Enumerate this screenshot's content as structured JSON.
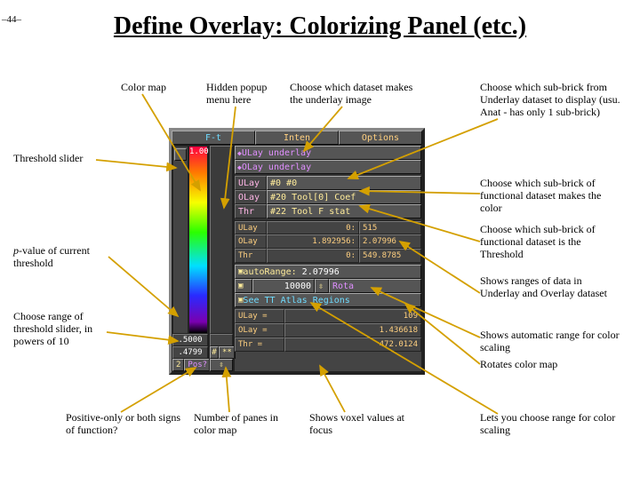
{
  "page_number": "–44–",
  "title": "Define Overlay: Colorizing Panel (etc.)",
  "notes": {
    "colormap": "Color map",
    "hidden_popup": "Hidden popup menu here",
    "choose_underlay_ds": "Choose which dataset makes the underlay image",
    "choose_subbrick_ul": "Choose which sub-brick from Underlay dataset to display (usu. Anat - has only 1 sub-brick)",
    "thresh_slider": "Threshold slider",
    "choose_subbrick_color": "Choose which sub-brick of functional dataset makes the color",
    "pval": "p-value of current threshold",
    "pval_em": "p",
    "pval_rest": "-value of current threshold",
    "choose_subbrick_thr": "Choose which sub-brick of functional dataset is the Threshold",
    "ranges_note": "Shows ranges of data in Underlay and Overlay dataset",
    "range_slider": "Choose range of threshold slider, in powers of 10",
    "auto_range": "Shows automatic range for color scaling",
    "rota": "Rotates color map",
    "posneg": "Positive-only or both signs of function?",
    "panes": "Number of panes in color map",
    "voxel_focus": "Shows voxel values at focus",
    "user_range": "Lets you choose range for color scaling"
  },
  "panel": {
    "top": {
      "left": "F-t",
      "inten": "Inten",
      "options": "Options"
    },
    "grad_top": "1.00",
    "left": {
      "pval": ".5000",
      "thr_exp_a": ".4799",
      "thr_exp_b": "2",
      "pos": "Pos?"
    },
    "sign": {
      "panes": "#",
      "stars": "**",
      "arrows": "⇳"
    },
    "ulay_olay": {
      "ulay": "ULay underlay",
      "olay": "OLay underlay"
    },
    "rows": {
      "ulay_lab": "ULay",
      "ulay_val": "#0 #0",
      "olay_lab": "OLay",
      "olay_val": "#20 Tool[0] Coef",
      "thr_lab": "Thr",
      "thr_val": "#22 Tool F stat"
    },
    "ranges": {
      "ulab": "ULay",
      "u0": "0:",
      "u1": "515",
      "olab": "OLay",
      "o0": "1.892956:",
      "o1": "2.07996",
      "tlab": "Thr",
      "t0": "0:",
      "t1": "549.8785"
    },
    "auto": {
      "tog": "autoRange:",
      "val": "2.07996"
    },
    "range": {
      "tog": "",
      "num": "10000",
      "rota": "Rota"
    },
    "atlas": "See TT Atlas Regions",
    "focus": {
      "ulab": "ULay =",
      "u": "109",
      "olab": "OLay =",
      "o": "1.436618",
      "tlab": "Thr  =",
      "t": "472.0124"
    }
  }
}
